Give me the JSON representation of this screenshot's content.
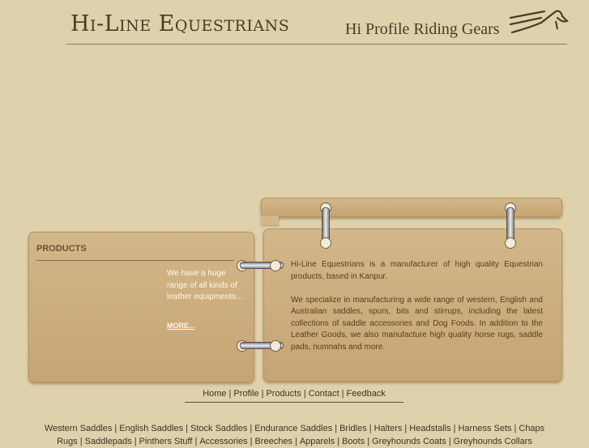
{
  "header": {
    "brand": "Hi-Line Equestrians",
    "tagline": "Hi Profile Riding Gears",
    "logo_icon": "horse-saddle-logo-icon"
  },
  "products": {
    "title": "PRODUCTS",
    "text": "We have a huge range of all kinds of leather equipments...",
    "more_label": "MORE..."
  },
  "about": {
    "para1": "Hi-Line Equestrians  is a manufacturer of high quality Equestrian products, based in Kanpur.",
    "para2": "We specialize in manufacturing a wide range of western, English and Australian saddles, spurs, bits and stirrups, including the latest collections of saddle accessories and Dog Foods. In addition to the Leather Goods, we also manufacture high quality horse rugs, saddle pads, numnahs and more."
  },
  "nav": {
    "items": [
      "Home",
      "Profile",
      "Products",
      "Contact",
      "Feedback"
    ]
  },
  "categories": {
    "line1": [
      "Western Saddles",
      "English Saddles",
      "Stock Saddles",
      "Endurance Saddles",
      "Bridles",
      "Halters",
      "Headstalls",
      "Harness Sets",
      "Chaps"
    ],
    "line2": [
      "Rugs",
      "Saddlepads",
      "Pinthers Stuff",
      "Accessories",
      "Breeches",
      "Apparels",
      "Boots",
      "Greyhounds Coats",
      "Greyhounds Collars"
    ]
  },
  "colors": {
    "background": "#dfd1ac",
    "board": "#cbac7c",
    "text_dark": "#4a3b22"
  }
}
